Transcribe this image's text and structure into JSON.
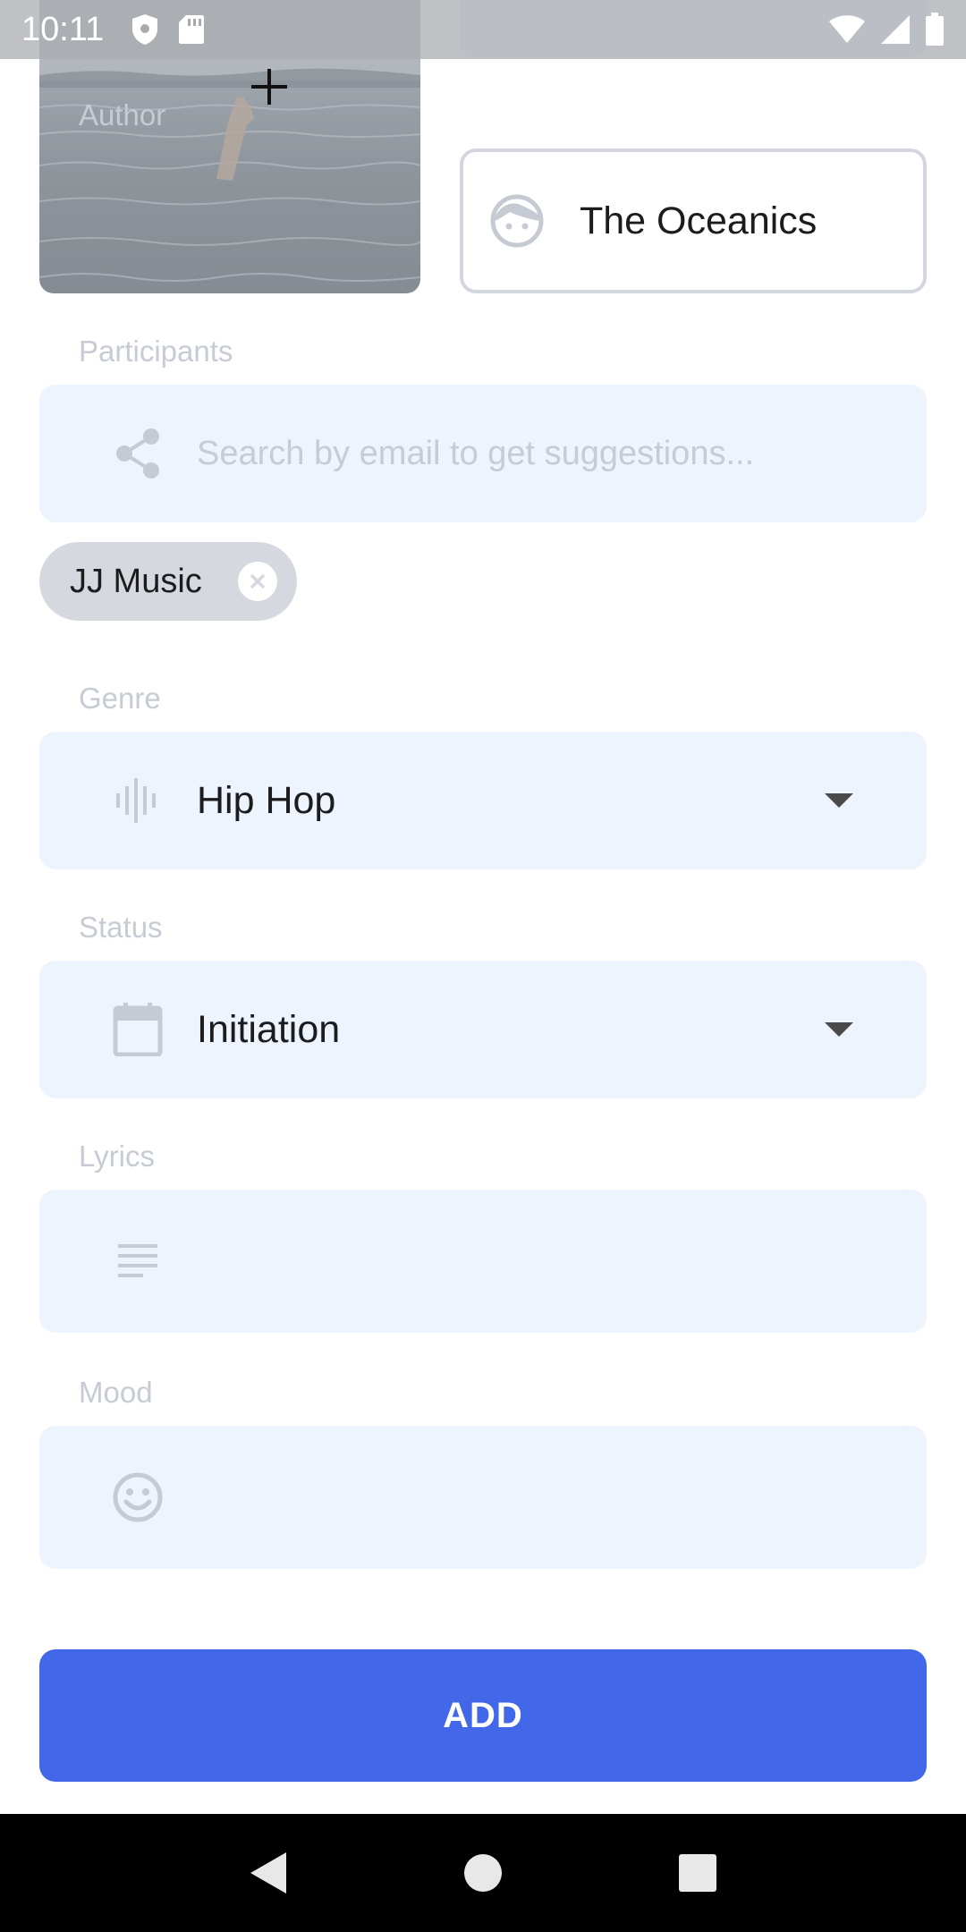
{
  "status_bar": {
    "time": "10:11"
  },
  "form": {
    "author": {
      "label": "Author",
      "value": "The Oceanics"
    },
    "participants": {
      "label": "Participants",
      "placeholder": "Search by email to get suggestions...",
      "chips": [
        {
          "label": "JJ Music"
        }
      ]
    },
    "genre": {
      "label": "Genre",
      "value": "Hip Hop"
    },
    "status": {
      "label": "Status",
      "value": "Initiation"
    },
    "lyrics": {
      "label": "Lyrics",
      "value": ""
    },
    "mood": {
      "label": "Mood",
      "value": ""
    },
    "submit_label": "ADD"
  },
  "colors": {
    "accent": "#4267e8",
    "field_bg": "#eef4fe",
    "label": "#c7cbd4",
    "chip_bg": "#d5d8de"
  },
  "icons": {
    "cover_add": "plus-icon",
    "author": "face-icon",
    "participants": "share-icon",
    "genre": "audio-wave-icon",
    "status": "calendar-icon",
    "lyrics": "lines-icon",
    "mood": "smiley-icon"
  }
}
